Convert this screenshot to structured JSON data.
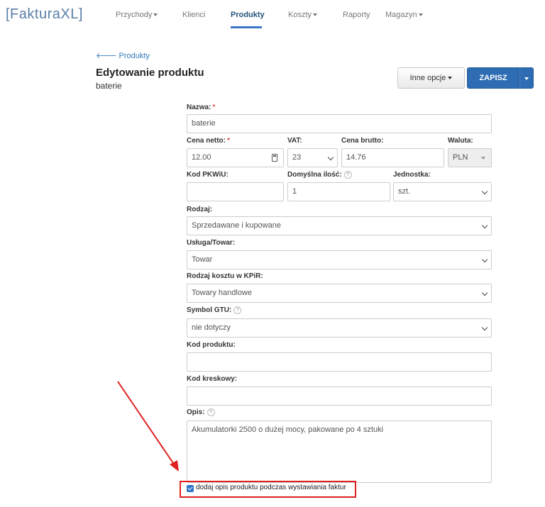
{
  "brand": "[FakturaXL]",
  "nav": {
    "items": [
      {
        "label": "Przychody",
        "dropdown": true
      },
      {
        "label": "Klienci",
        "dropdown": false
      },
      {
        "label": "Produkty",
        "dropdown": false,
        "active": true
      },
      {
        "label": "Koszty",
        "dropdown": true
      },
      {
        "label": "Raporty",
        "dropdown": false
      },
      {
        "label": "Magazyn",
        "dropdown": true
      }
    ]
  },
  "breadcrumb": {
    "back_label": "Produkty"
  },
  "header": {
    "title": "Edytowanie produktu",
    "subtitle": "baterie"
  },
  "toolbar": {
    "other_options_label": "Inne opcje",
    "save_label": "ZAPISZ"
  },
  "form": {
    "name": {
      "label": "Nazwa:",
      "value": "baterie"
    },
    "net_price": {
      "label": "Cena netto:",
      "value": "12.00"
    },
    "vat": {
      "label": "VAT:",
      "value": "23"
    },
    "gross_price": {
      "label": "Cena brutto:",
      "value": "14.76"
    },
    "currency": {
      "label": "Waluta:",
      "value": "PLN"
    },
    "pkwiu": {
      "label": "Kod PKWiU:",
      "value": ""
    },
    "default_qty": {
      "label": "Domyślna ilość:",
      "value": "1"
    },
    "unit": {
      "label": "Jednostka:",
      "value": "szt."
    },
    "kind": {
      "label": "Rodzaj:",
      "value": "Sprzedawane i kupowane"
    },
    "service_goods": {
      "label": "Usługa/Towar:",
      "value": "Towar"
    },
    "kpir_cost": {
      "label": "Rodzaj kosztu w KPiR:",
      "value": "Towary handlowe"
    },
    "gtu": {
      "label": "Symbol GTU:",
      "value": "nie dotyczy"
    },
    "product_code": {
      "label": "Kod produktu:",
      "value": ""
    },
    "barcode": {
      "label": "Kod kreskowy:",
      "value": ""
    },
    "description": {
      "label": "Opis:",
      "value": "Akumulatorki 2500 o dużej mocy, pakowane po 4 sztuki"
    },
    "add_description_checkbox": {
      "label": "dodaj opis produktu podczas wystawiania faktur",
      "checked": true
    }
  },
  "colors": {
    "accent": "#2e6cb3",
    "annotation": "#e02020",
    "required": "#d9534f"
  }
}
